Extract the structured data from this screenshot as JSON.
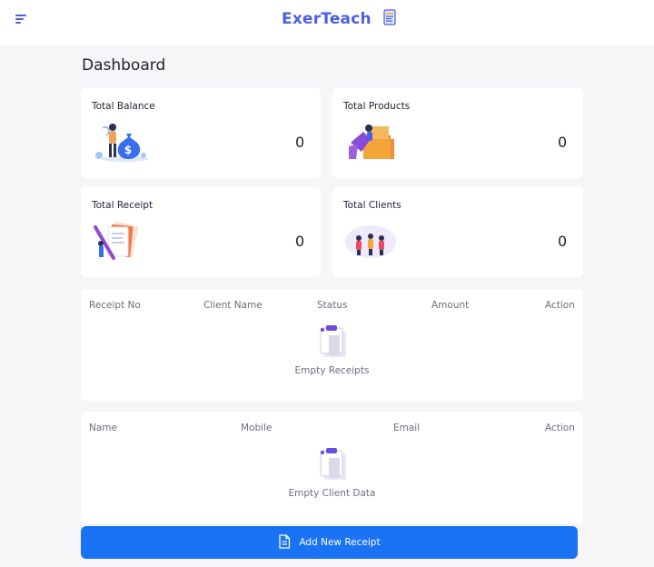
{
  "header": {
    "app_title": "ExerTeach",
    "menu_icon": "menu-icon",
    "logo_icon": "receipt-logo-icon"
  },
  "page": {
    "title": "Dashboard"
  },
  "stats": [
    {
      "label": "Total Balance",
      "value": "0",
      "icon": "money-bag-illustration"
    },
    {
      "label": "Total Products",
      "value": "0",
      "icon": "product-boxes-illustration"
    },
    {
      "label": "Total Receipt",
      "value": "0",
      "icon": "receipt-pencil-illustration"
    },
    {
      "label": "Total Clients",
      "value": "0",
      "icon": "clients-group-illustration"
    }
  ],
  "receipts_table": {
    "columns": [
      "Receipt No",
      "Client Name",
      "Status",
      "Amount",
      "Action"
    ],
    "empty_text": "Empty Receipts",
    "empty_icon": "clipboard-icon"
  },
  "clients_table": {
    "columns": [
      "Name",
      "Mobile",
      "Email",
      "Action"
    ],
    "empty_text": "Empty Client Data",
    "empty_icon": "clipboard-icon"
  },
  "actions": {
    "add_receipt": "Add New Receipt",
    "add_receipt_icon": "document-icon"
  },
  "colors": {
    "brand": "#4b5ee8",
    "primary_button": "#1a73f5",
    "background": "#f6f6f8",
    "card": "#ffffff"
  }
}
